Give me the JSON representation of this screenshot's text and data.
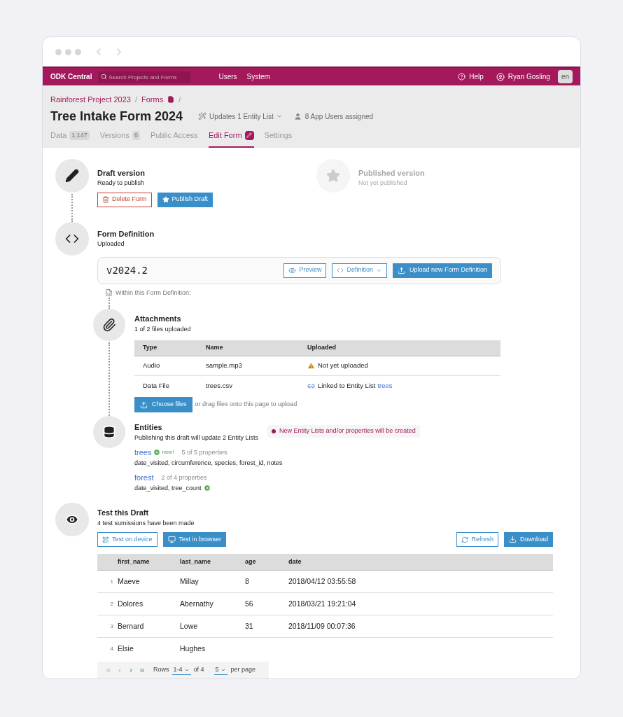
{
  "navbar": {
    "brand": "ODK Central",
    "search": {
      "placeholder": "Search Projects and Forms"
    },
    "links": [
      "Users",
      "System"
    ],
    "help": "Help",
    "user": "Ryan Gosling",
    "language": "en"
  },
  "header": {
    "breadcrumbs": [
      "Rainforest Project 2023",
      "Forms"
    ],
    "separators": [
      "/",
      "/"
    ],
    "title": "Tree Intake Form 2024",
    "entity_info": "Updates 1 Entity List",
    "app_users": "8 App Users assigned",
    "tabs": [
      {
        "label": "Data",
        "badge": "1,147",
        "selected": false
      },
      {
        "label": "Versions",
        "badge": "6",
        "selected": false
      },
      {
        "label": "Public Access",
        "selected": false
      },
      {
        "label": "Edit Form",
        "selected": true
      },
      {
        "label": "Settings",
        "selected": false
      }
    ]
  },
  "draft": {
    "title": "Draft version",
    "subtitle": "Ready to publish",
    "delete_button": "Delete Form",
    "publish_button": "Publish Draft"
  },
  "published": {
    "title": "Published version",
    "subtitle": "Not yet published"
  },
  "form_definition": {
    "title": "Form Definition",
    "subtitle": "Uploaded",
    "version": "v2024.2",
    "preview_button": "Preview",
    "definition_button": "Definition",
    "upload_button": "Upload new Form Definition",
    "within_label": "Within this Form Definition:"
  },
  "attachments": {
    "title": "Attachments",
    "subtitle": "1 of 2 files uploaded",
    "columns": [
      "Type",
      "Name",
      "Uploaded"
    ],
    "rows": [
      {
        "type": "Audio",
        "name": "sample.mp3",
        "kind": "warning",
        "status": "Not yet uploaded"
      },
      {
        "type": "Data File",
        "name": "trees.csv",
        "kind": "linked",
        "status": "Linked to Entity List",
        "link": "trees"
      }
    ],
    "choose_button": "Choose files",
    "drag_hint": "or drag files onto this page to upload"
  },
  "entities": {
    "title": "Entities",
    "subtitle": "Publishing this draft will update 2 Entity Lists",
    "notice": "New Entity Lists and/or properties will be created",
    "lists": [
      {
        "name": "trees",
        "is_new": true,
        "new_label": "new!",
        "count": "5 of 5 properties",
        "properties": "date_visited, circumference, species, forest_id, notes",
        "new_property": false
      },
      {
        "name": "forest",
        "is_new": false,
        "count": "2 of 4 properties",
        "properties": "date_visited, tree_count",
        "new_property": true
      }
    ]
  },
  "test": {
    "title": "Test this Draft",
    "subtitle": "4 test sumissions have been made",
    "device_button": "Test on device",
    "browser_button": "Test in browser",
    "refresh_button": "Refresh",
    "download_button": "Download",
    "columns": [
      "first_name",
      "last_name",
      "age",
      "date"
    ],
    "rows": [
      {
        "index": "1",
        "cells": [
          "Maeve",
          "Millay",
          "8",
          "2018/04/12 03:55:58"
        ]
      },
      {
        "index": "2",
        "cells": [
          "Dolores",
          "Abernathy",
          "56",
          "2018/03/21 19:21:04"
        ]
      },
      {
        "index": "3",
        "cells": [
          "Bernard",
          "Lowe",
          "31",
          "2018/11/09 00:07:36"
        ]
      },
      {
        "index": "4",
        "cells": [
          "Elsie",
          "Hughes"
        ]
      }
    ],
    "pagination": {
      "buttons": [
        {
          "label": "«",
          "disabled": true
        },
        {
          "label": "‹",
          "disabled": true
        },
        {
          "label": "›",
          "disabled": false
        },
        {
          "label": "»",
          "disabled": false
        }
      ],
      "rows_label": "Rows",
      "range": "1-4",
      "of": "of 4",
      "per_page_value": "5",
      "per_page_label": "per page"
    }
  }
}
